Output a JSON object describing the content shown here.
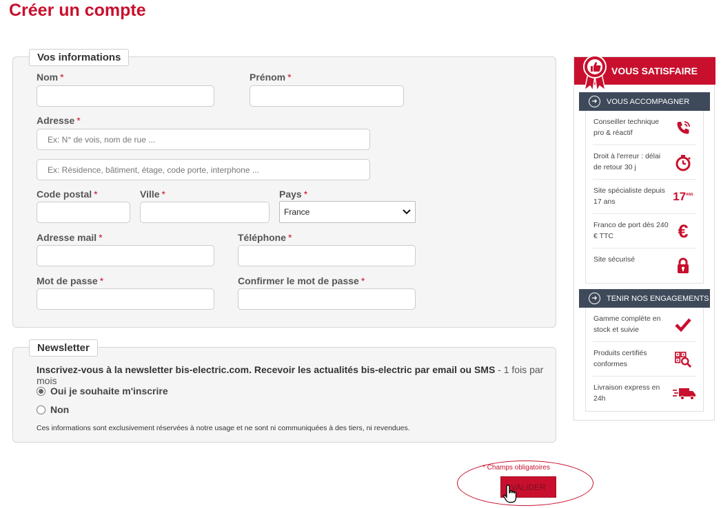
{
  "page": {
    "title": "Créer un compte"
  },
  "info": {
    "legend": "Vos informations",
    "nom_label": "Nom",
    "prenom_label": "Prénom",
    "adresse_label": "Adresse",
    "adresse1_placeholder": "Ex: N° de vois, nom de rue ...",
    "adresse2_placeholder": "Ex: Résidence, bâtiment, étage, code porte, interphone ...",
    "cp_label": "Code postal",
    "ville_label": "Ville",
    "pays_label": "Pays",
    "pays_value": "France",
    "mail_label": "Adresse mail",
    "tel_label": "Téléphone",
    "mdp_label": "Mot de passe",
    "mdp2_label": "Confirmer le mot de passe",
    "required_mark": "*"
  },
  "newsletter": {
    "legend": "Newsletter",
    "text_bold": "Inscrivez-vous à la newsletter bis-electric.com. Recevoir les actualités bis-electric par email ou SMS",
    "text_freq": " - 1 fois par mois",
    "option_yes": "Oui je souhaite m'inscrire",
    "option_no": "Non",
    "selected": "yes",
    "note": "Ces informations sont exclusivement réservées à notre usage et ne sont ni communiquées à des tiers, ni revendues."
  },
  "sidebar": {
    "title": "VOUS SATISFAIRE",
    "section1": {
      "heading": "VOUS ACCOMPAGNER",
      "items": [
        {
          "text": "Conseiller technique pro & réactif",
          "icon": "phone-icon"
        },
        {
          "text": "Droit à l'erreur : délai de retour 30 j",
          "icon": "stopwatch-icon"
        },
        {
          "text": "Site spécialiste depuis 17 ans",
          "icon": "17-ans-badge",
          "badge_number": "17",
          "badge_unit": "ANS"
        },
        {
          "text": "Franco de port dès 240 € TTC",
          "icon": "euro-icon"
        },
        {
          "text": "Site sécurisé",
          "icon": "lock-icon"
        }
      ]
    },
    "section2": {
      "heading": "TENIR NOS ENGAGEMENTS",
      "items": [
        {
          "text": "Gamme complète en stock et suivie",
          "icon": "check-icon"
        },
        {
          "text": "Produits certifiés conformes",
          "icon": "qr-search-icon"
        },
        {
          "text": "Livraison express en 24h",
          "icon": "delivery-truck-icon"
        }
      ]
    }
  },
  "footer": {
    "required_note": "* Champs obligatoires",
    "submit_label": "VALIDER"
  },
  "colors": {
    "accent": "#c8102e",
    "dark": "#3e4a5a"
  }
}
